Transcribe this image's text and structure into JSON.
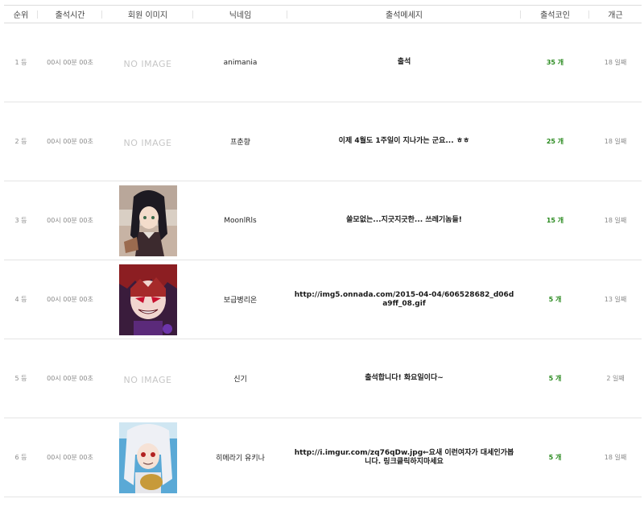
{
  "headers": {
    "rank": "순위",
    "time": "출석시간",
    "image": "회원 이미지",
    "nickname": "닉네임",
    "message": "출석메세지",
    "coin": "출석코인",
    "streak": "개근"
  },
  "rows": [
    {
      "rank": "1 등",
      "time": "00시 00분 00초",
      "image": "NO IMAGE",
      "nickname": "animania",
      "message": "출석",
      "coin": "35",
      "coin_unit": "개",
      "streak": "18 일째"
    },
    {
      "rank": "2 등",
      "time": "00시 00분 00초",
      "image": "NO IMAGE",
      "nickname": "프춘향",
      "message": "이제 4월도 1주일이 지나가는 군요... ㅎㅎ",
      "coin": "25",
      "coin_unit": "개",
      "streak": "18 일째"
    },
    {
      "rank": "3 등",
      "time": "00시 00분 00초",
      "image": "",
      "nickname": "MoonlRls",
      "message": "쓸모없는...지긋지긋한... 쓰레기놈들!",
      "coin": "15",
      "coin_unit": "개",
      "streak": "18 일째"
    },
    {
      "rank": "4 등",
      "time": "00시 00분 00초",
      "image": "",
      "nickname": "보급병리온",
      "message": "http://img5.onnada.com/2015-04-04/606528682_d06da9ff_08.gif",
      "coin": "5",
      "coin_unit": "개",
      "streak": "13 일째"
    },
    {
      "rank": "5 등",
      "time": "00시 00분 00초",
      "image": "NO IMAGE",
      "nickname": "신기",
      "message": "출석합니다! 화요일이다~",
      "coin": "5",
      "coin_unit": "개",
      "streak": "2 일째"
    },
    {
      "rank": "6 등",
      "time": "00시 00분 00초",
      "image": "",
      "nickname": "히메라기 유키나",
      "message": "http://i.imgur.com/zq76qDw.jpg←요새 이런여자가 대세인가봅니다. 링크클릭하지마세요",
      "coin": "5",
      "coin_unit": "개",
      "streak": "18 일째"
    }
  ],
  "colors": {
    "coin": "#2a8a1f",
    "border": "#e4e4e4",
    "noimage": "#c6c6c6"
  }
}
